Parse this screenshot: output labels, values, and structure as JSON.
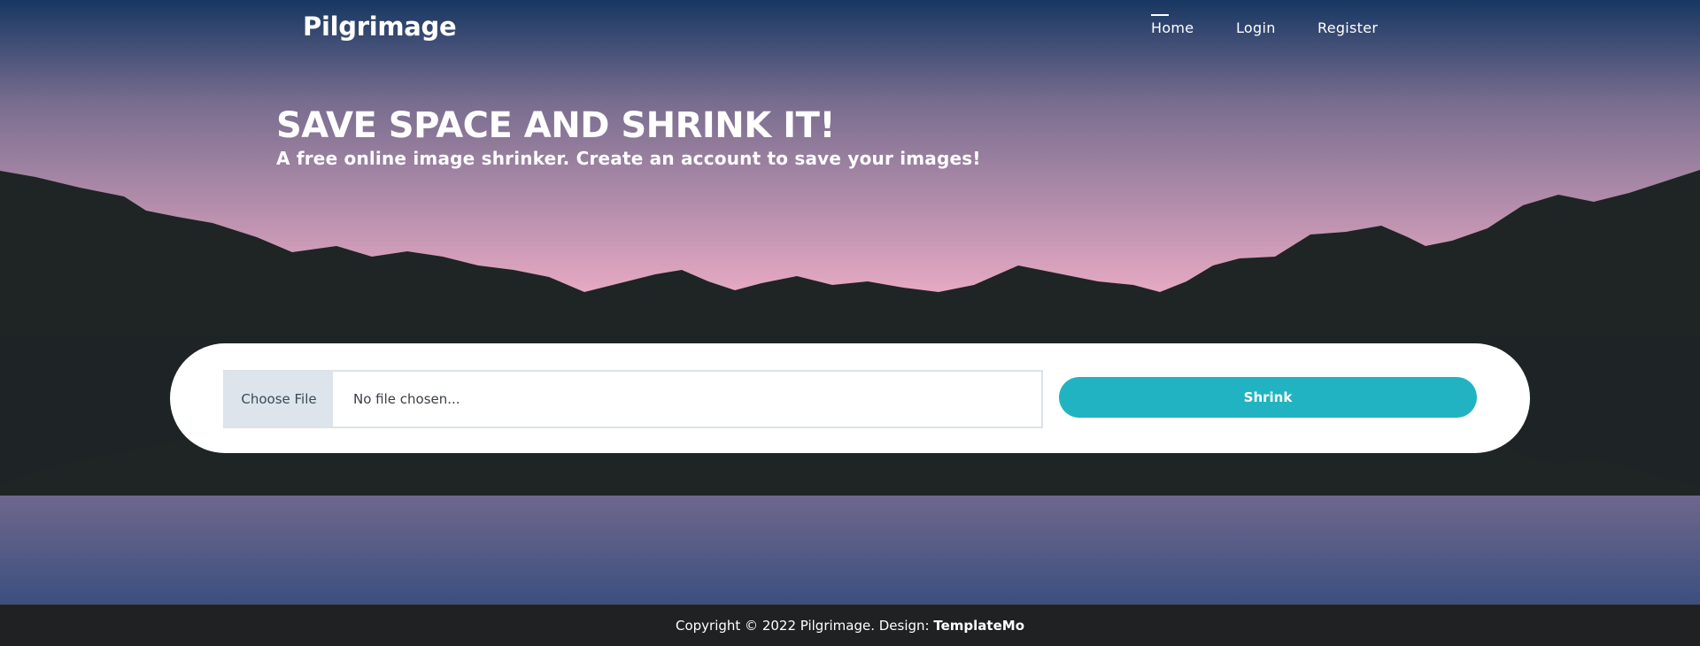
{
  "brand": "Pilgrimage",
  "nav": [
    {
      "label": "Home",
      "active": true
    },
    {
      "label": "Login",
      "active": false
    },
    {
      "label": "Register",
      "active": false
    }
  ],
  "hero": {
    "title": "SAVE SPACE AND SHRINK IT!",
    "subtitle": "A free online image shrinker. Create an account to save your images!"
  },
  "upload": {
    "choose_label": "Choose File",
    "file_status": "No file chosen...",
    "submit_label": "Shrink"
  },
  "footer": {
    "text": "Copyright © 2022 Pilgrimage. Design: ",
    "link_label": "TemplateMo"
  },
  "colors": {
    "accent": "#21b3c1",
    "sky_top": "#173762",
    "sky_horizon": "#e6a9c3",
    "mountains": "#1f2425",
    "footer_bg": "#1f2122"
  }
}
